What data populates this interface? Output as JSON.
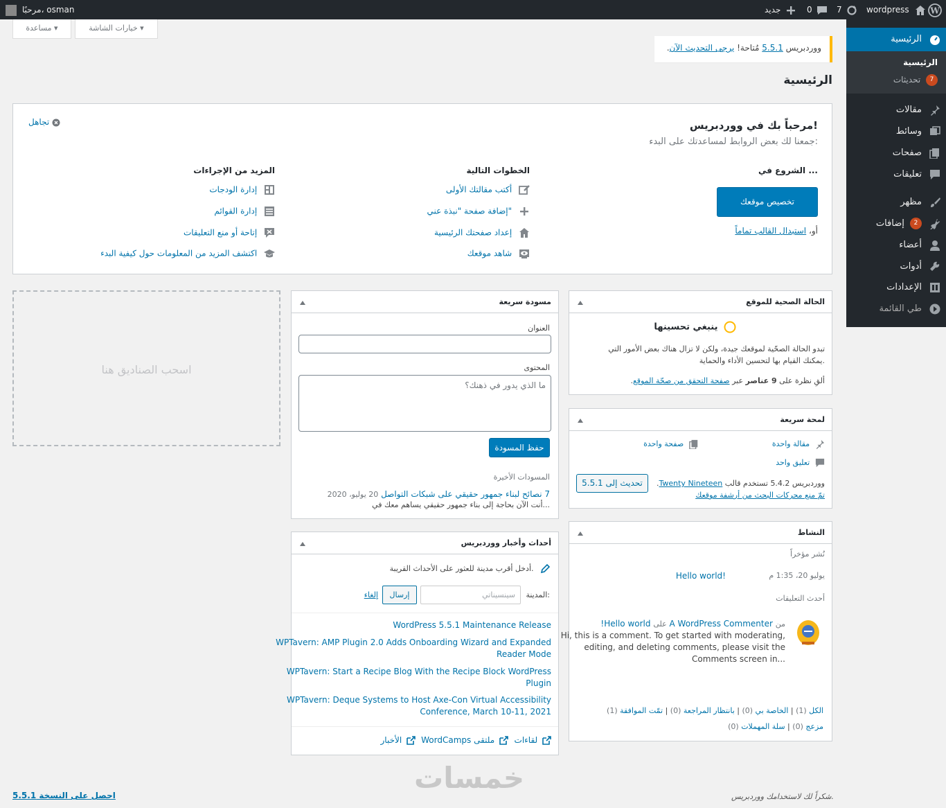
{
  "admin_bar": {
    "greeting": "مرحبًا، osman",
    "site_name": "wordpress",
    "updates_count": "7",
    "comments_count": "0",
    "new_label": "جديد"
  },
  "sidebar": {
    "items": [
      {
        "label": "الرئيسية",
        "icon": "dashboard-icon"
      },
      {
        "label": "مقالات",
        "icon": "pin-icon"
      },
      {
        "label": "وسائط",
        "icon": "media-icon"
      },
      {
        "label": "صفحات",
        "icon": "pages-icon"
      },
      {
        "label": "تعليقات",
        "icon": "comments-icon"
      },
      {
        "label": "مظهر",
        "icon": "brush-icon"
      },
      {
        "label": "إضافات",
        "icon": "plugin-icon",
        "badge": "2"
      },
      {
        "label": "أعضاء",
        "icon": "user-icon"
      },
      {
        "label": "أدوات",
        "icon": "wrench-icon"
      },
      {
        "label": "الإعدادات",
        "icon": "settings-icon"
      },
      {
        "label": "طي القائمة",
        "icon": "collapse-icon"
      }
    ],
    "sub": {
      "home": "الرئيسية",
      "updates": "تحديثات",
      "updates_badge": "7"
    }
  },
  "tabs": {
    "screen_options": "خيارات الشاشة",
    "help": "مساعدة"
  },
  "notice": {
    "pre": "ووردبريس ",
    "version": "5.5.1",
    "mid": " مُتاحة! ",
    "link": "يرجى التحديث الآن",
    "post": "."
  },
  "page_title": "الرئيسية",
  "welcome": {
    "title": "مرحباً بك في ووردبريس!",
    "subtitle": "جمعنا لك بعض الروابط لمساعدتك على البدء:",
    "dismiss": "تجاهل",
    "col1_title": "الشروع في ...",
    "customize_button": "تخصيص موقعك",
    "or": "أو،",
    "replace_theme": "استبدال القالب تماماً",
    "col2_title": "الخطوات التالية",
    "col2_items": [
      {
        "label": "أكتب مقالتك الأولى",
        "icon": "edit-icon"
      },
      {
        "label": "إضافة صفحة \"نبذة عني\"",
        "icon": "plus-icon"
      },
      {
        "label": "إعداد صفحتك الرئيسية",
        "icon": "home-icon"
      },
      {
        "label": "شاهد موقعك",
        "icon": "view-icon"
      }
    ],
    "col3_title": "المزيد من الإجراءات",
    "col3_items": [
      {
        "label": "إدارة الودجات",
        "icon": "widgets-icon"
      },
      {
        "label": "إدارة القوائم",
        "icon": "menus-icon"
      },
      {
        "label": "إتاحة أو منع التعليقات",
        "icon": "comments-toggle-icon"
      },
      {
        "label": "اكتشف المزيد من المعلومات حول كيفية البدء",
        "icon": "learn-icon"
      }
    ]
  },
  "site_health": {
    "title": "الحالة الصحية للموقع",
    "status": "ينبغي تحسينها",
    "desc1": "تبدو الحالة الصحّية لموقعك جيدة، ولكن لا تزال هناك بعض الأمور التي",
    "desc2": "يمكنك القيام بها لتحسين الأداء والحماية.",
    "items_pre": "ألقِ نظرة على ",
    "items_count": "9 عناصر",
    "items_mid": " عبر ",
    "items_link": "صفحة التحقق من صحّة الموقع",
    "items_post": "."
  },
  "glance": {
    "title": "لمحة سريعة",
    "posts": "مقالة واحدة",
    "pages": "صفحة واحدة",
    "comments": "تعليق واحد",
    "wp_version_pre": "ووردبريس 5.4.2 تستخدم قالب ",
    "theme": "Twenty Nineteen",
    "post": ".",
    "update_button": "تحديث إلى 5.5.1",
    "search_engines": "تمّ منع محركات البحث من أرشفة موقعك"
  },
  "activity": {
    "title": "النشاط",
    "recent_published": "نُشر مؤخراً",
    "date": "يوليو 20، 1:35 م",
    "post_link": "Hello world!",
    "recent_comments": "أحدث التعليقات",
    "comment_from": "من",
    "commenter": "A WordPress Commenter",
    "comment_on": "على",
    "comment_post": "Hello world!",
    "comment_text": [
      "Hi, this is a comment. To get started with moderating,",
      "editing, and deleting comments, please visit the",
      "Comments screen in..."
    ],
    "filters_row1": [
      {
        "label": "الكل",
        "count": "(1)"
      },
      {
        "label": "الخاصة بي",
        "count": "(0)"
      },
      {
        "label": "بانتظار المراجعة",
        "count": "(0)"
      },
      {
        "label": "تمّت الموافقة",
        "count": "(1)"
      }
    ],
    "filters_row2": [
      {
        "label": "مزعج",
        "count": "(0)"
      },
      {
        "label": "سلة المهملات",
        "count": "(0)"
      }
    ]
  },
  "quick_draft": {
    "title": "مسودة سريعة",
    "title_label": "العنوان",
    "content_label": "المحتوى",
    "content_placeholder": "ما الذي يدور في ذهنك؟",
    "save_button": "حفظ المسودة",
    "recent_drafts": "المسودات الأخيرة",
    "draft_link": "7 نصائح لبناء جمهور حقيقي على شبكات التواصل",
    "draft_date": "20 يوليو، 2020",
    "draft_excerpt": "أنت الآن بحاجة إلى بناء جمهور حقيقي يساهم معك في..."
  },
  "events": {
    "title": "أحداث وأخبار ووردبريس",
    "intro": "أدخل أقرب مدينة للعثور على الأحداث القريبة.",
    "city_label": "المدينة:",
    "city_placeholder": "سينسيناتي",
    "submit": "إرسال",
    "cancel": "إلغاء",
    "news": [
      [
        "WordPress 5.5.1 Maintenance Release"
      ],
      [
        "WPTavern: AMP Plugin 2.0 Adds Onboarding Wizard and Expanded",
        "Reader Mode"
      ],
      [
        "WPTavern: Start a Recipe Blog With the Recipe Block WordPress",
        "Plugin"
      ],
      [
        "WPTavern: Deque Systems to Host Axe-Con Virtual Accessibility",
        "Conference, March 10-11, 2021"
      ]
    ],
    "footer": [
      "لقاءات",
      "WordCamps ملتقى",
      "الأخبار"
    ]
  },
  "drop_zone": "اسحب الصناديق هنا",
  "footer": {
    "thanks": "شكراً لك لاستخدامك ووردبريس.",
    "get_version": "احصل على النسخة 5.5.1"
  },
  "watermark": "خمسات"
}
